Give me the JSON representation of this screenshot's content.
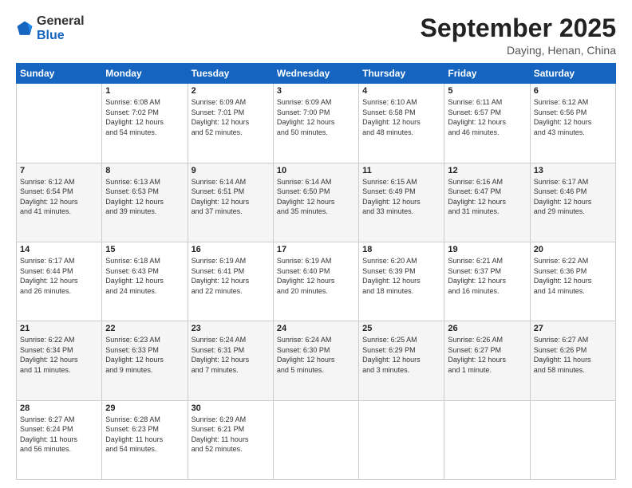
{
  "header": {
    "logo": {
      "line1": "General",
      "line2": "Blue"
    },
    "title": "September 2025",
    "location": "Daying, Henan, China"
  },
  "days_of_week": [
    "Sunday",
    "Monday",
    "Tuesday",
    "Wednesday",
    "Thursday",
    "Friday",
    "Saturday"
  ],
  "weeks": [
    [
      {
        "num": "",
        "info": ""
      },
      {
        "num": "1",
        "info": "Sunrise: 6:08 AM\nSunset: 7:02 PM\nDaylight: 12 hours\nand 54 minutes."
      },
      {
        "num": "2",
        "info": "Sunrise: 6:09 AM\nSunset: 7:01 PM\nDaylight: 12 hours\nand 52 minutes."
      },
      {
        "num": "3",
        "info": "Sunrise: 6:09 AM\nSunset: 7:00 PM\nDaylight: 12 hours\nand 50 minutes."
      },
      {
        "num": "4",
        "info": "Sunrise: 6:10 AM\nSunset: 6:58 PM\nDaylight: 12 hours\nand 48 minutes."
      },
      {
        "num": "5",
        "info": "Sunrise: 6:11 AM\nSunset: 6:57 PM\nDaylight: 12 hours\nand 46 minutes."
      },
      {
        "num": "6",
        "info": "Sunrise: 6:12 AM\nSunset: 6:56 PM\nDaylight: 12 hours\nand 43 minutes."
      }
    ],
    [
      {
        "num": "7",
        "info": "Sunrise: 6:12 AM\nSunset: 6:54 PM\nDaylight: 12 hours\nand 41 minutes."
      },
      {
        "num": "8",
        "info": "Sunrise: 6:13 AM\nSunset: 6:53 PM\nDaylight: 12 hours\nand 39 minutes."
      },
      {
        "num": "9",
        "info": "Sunrise: 6:14 AM\nSunset: 6:51 PM\nDaylight: 12 hours\nand 37 minutes."
      },
      {
        "num": "10",
        "info": "Sunrise: 6:14 AM\nSunset: 6:50 PM\nDaylight: 12 hours\nand 35 minutes."
      },
      {
        "num": "11",
        "info": "Sunrise: 6:15 AM\nSunset: 6:49 PM\nDaylight: 12 hours\nand 33 minutes."
      },
      {
        "num": "12",
        "info": "Sunrise: 6:16 AM\nSunset: 6:47 PM\nDaylight: 12 hours\nand 31 minutes."
      },
      {
        "num": "13",
        "info": "Sunrise: 6:17 AM\nSunset: 6:46 PM\nDaylight: 12 hours\nand 29 minutes."
      }
    ],
    [
      {
        "num": "14",
        "info": "Sunrise: 6:17 AM\nSunset: 6:44 PM\nDaylight: 12 hours\nand 26 minutes."
      },
      {
        "num": "15",
        "info": "Sunrise: 6:18 AM\nSunset: 6:43 PM\nDaylight: 12 hours\nand 24 minutes."
      },
      {
        "num": "16",
        "info": "Sunrise: 6:19 AM\nSunset: 6:41 PM\nDaylight: 12 hours\nand 22 minutes."
      },
      {
        "num": "17",
        "info": "Sunrise: 6:19 AM\nSunset: 6:40 PM\nDaylight: 12 hours\nand 20 minutes."
      },
      {
        "num": "18",
        "info": "Sunrise: 6:20 AM\nSunset: 6:39 PM\nDaylight: 12 hours\nand 18 minutes."
      },
      {
        "num": "19",
        "info": "Sunrise: 6:21 AM\nSunset: 6:37 PM\nDaylight: 12 hours\nand 16 minutes."
      },
      {
        "num": "20",
        "info": "Sunrise: 6:22 AM\nSunset: 6:36 PM\nDaylight: 12 hours\nand 14 minutes."
      }
    ],
    [
      {
        "num": "21",
        "info": "Sunrise: 6:22 AM\nSunset: 6:34 PM\nDaylight: 12 hours\nand 11 minutes."
      },
      {
        "num": "22",
        "info": "Sunrise: 6:23 AM\nSunset: 6:33 PM\nDaylight: 12 hours\nand 9 minutes."
      },
      {
        "num": "23",
        "info": "Sunrise: 6:24 AM\nSunset: 6:31 PM\nDaylight: 12 hours\nand 7 minutes."
      },
      {
        "num": "24",
        "info": "Sunrise: 6:24 AM\nSunset: 6:30 PM\nDaylight: 12 hours\nand 5 minutes."
      },
      {
        "num": "25",
        "info": "Sunrise: 6:25 AM\nSunset: 6:29 PM\nDaylight: 12 hours\nand 3 minutes."
      },
      {
        "num": "26",
        "info": "Sunrise: 6:26 AM\nSunset: 6:27 PM\nDaylight: 12 hours\nand 1 minute."
      },
      {
        "num": "27",
        "info": "Sunrise: 6:27 AM\nSunset: 6:26 PM\nDaylight: 11 hours\nand 58 minutes."
      }
    ],
    [
      {
        "num": "28",
        "info": "Sunrise: 6:27 AM\nSunset: 6:24 PM\nDaylight: 11 hours\nand 56 minutes."
      },
      {
        "num": "29",
        "info": "Sunrise: 6:28 AM\nSunset: 6:23 PM\nDaylight: 11 hours\nand 54 minutes."
      },
      {
        "num": "30",
        "info": "Sunrise: 6:29 AM\nSunset: 6:21 PM\nDaylight: 11 hours\nand 52 minutes."
      },
      {
        "num": "",
        "info": ""
      },
      {
        "num": "",
        "info": ""
      },
      {
        "num": "",
        "info": ""
      },
      {
        "num": "",
        "info": ""
      }
    ]
  ]
}
